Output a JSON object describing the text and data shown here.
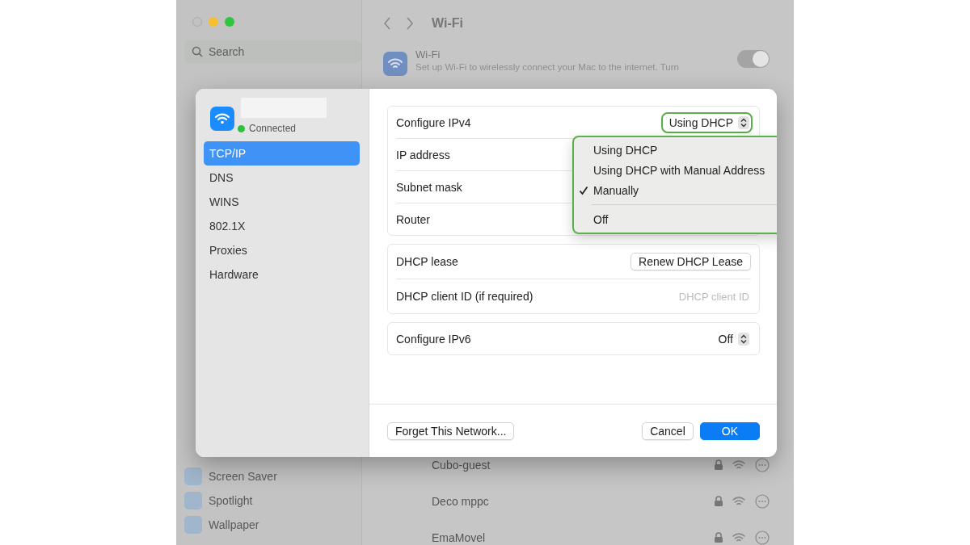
{
  "background_window": {
    "search": {
      "placeholder": "Search"
    },
    "title": "Wi-Fi",
    "wifi": {
      "label": "Wi-Fi",
      "on": true,
      "description": "Set up Wi-Fi to wirelessly connect your Mac to the internet. Turn"
    },
    "sidebar_items": [
      {
        "label": "Screen Saver"
      },
      {
        "label": "Spotlight"
      },
      {
        "label": "Wallpaper"
      }
    ],
    "networks": [
      {
        "name": "Cubo-guest"
      },
      {
        "name": "Deco mppc"
      },
      {
        "name": "EmaMovel"
      }
    ]
  },
  "sheet": {
    "status": "Connected",
    "tabs": [
      {
        "label": "TCP/IP",
        "selected": true
      },
      {
        "label": "DNS",
        "selected": false
      },
      {
        "label": "WINS",
        "selected": false
      },
      {
        "label": "802.1X",
        "selected": false
      },
      {
        "label": "Proxies",
        "selected": false
      },
      {
        "label": "Hardware",
        "selected": false
      }
    ],
    "ipv4": {
      "label": "Configure IPv4",
      "value": "Using DHCP",
      "rows": [
        "IP address",
        "Subnet mask",
        "Router"
      ]
    },
    "menu": [
      {
        "kind": "item",
        "label": "Using DHCP",
        "checked": false
      },
      {
        "kind": "item",
        "label": "Using DHCP with Manual Address",
        "checked": false
      },
      {
        "kind": "item",
        "label": "Manually",
        "checked": true
      },
      {
        "kind": "separator"
      },
      {
        "kind": "item",
        "label": "Off",
        "checked": false
      }
    ],
    "dhcp": {
      "label": "DHCP lease",
      "button": "Renew DHCP Lease",
      "client_label": "DHCP client ID (if required)",
      "client_placeholder": "DHCP client ID"
    },
    "ipv6": {
      "label": "Configure IPv6",
      "value": "Off"
    },
    "buttons": {
      "forget": "Forget This Network...",
      "cancel": "Cancel",
      "ok": "OK"
    }
  }
}
